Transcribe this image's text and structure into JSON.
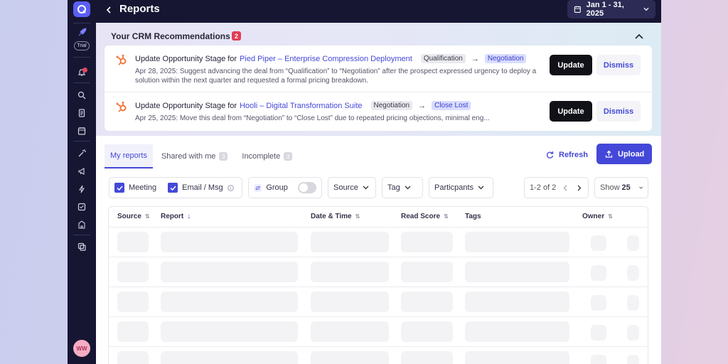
{
  "header": {
    "title": "Reports",
    "date_range": "Jan 1 - 31, 2025"
  },
  "sidebar": {
    "trial_label": "Trial",
    "avatar_initials": "WW"
  },
  "recommendations": {
    "title": "Your CRM Recommendations",
    "count": "2",
    "items": [
      {
        "prefix": "Update Opportunity Stage for",
        "deal": "Pied Piper – Enterprise Compression Deployment",
        "from_stage": "Qualification",
        "to_stage": "Negotiation",
        "description": "Apr 28, 2025: Suggest advancing the deal from “Qualification” to “Negotiation” after the prospect expressed urgency to deploy a solution within the next quarter and requested a formal pricing breakdown.",
        "update_label": "Update",
        "dismiss_label": "Dismiss"
      },
      {
        "prefix": "Update Opportunity Stage for",
        "deal": "Hooli – Digital Transformation Suite",
        "from_stage": "Negotiation",
        "to_stage": "Close Lost",
        "description": "Apr 25, 2025: Move this deal from “Negotiation” to “Close Lost” due to repeated pricing objections, minimal eng...",
        "update_label": "Update",
        "dismiss_label": "Dismiss"
      }
    ]
  },
  "tabs": [
    {
      "label": "My reports",
      "count": ""
    },
    {
      "label": "Shared with me",
      "count": "3"
    },
    {
      "label": "Incomplete",
      "count": "3"
    }
  ],
  "actions": {
    "refresh": "Refresh",
    "upload": "Upload"
  },
  "filters": {
    "meeting": "Meeting",
    "email_msg": "Email / Msg",
    "group": "Group",
    "source": "Source",
    "tag": "Tag",
    "participants": "Particpants",
    "pager_text": "1-2 of 2",
    "show_label": "Show",
    "show_value": "25"
  },
  "table": {
    "columns": [
      "Source",
      "Report",
      "Date & Time",
      "Read Score",
      "Tags",
      "Owner"
    ]
  },
  "colors": {
    "accent": "#4448d8",
    "sidebar": "#161633",
    "badge": "#e23d55",
    "hubspot": "#f07a3e"
  }
}
